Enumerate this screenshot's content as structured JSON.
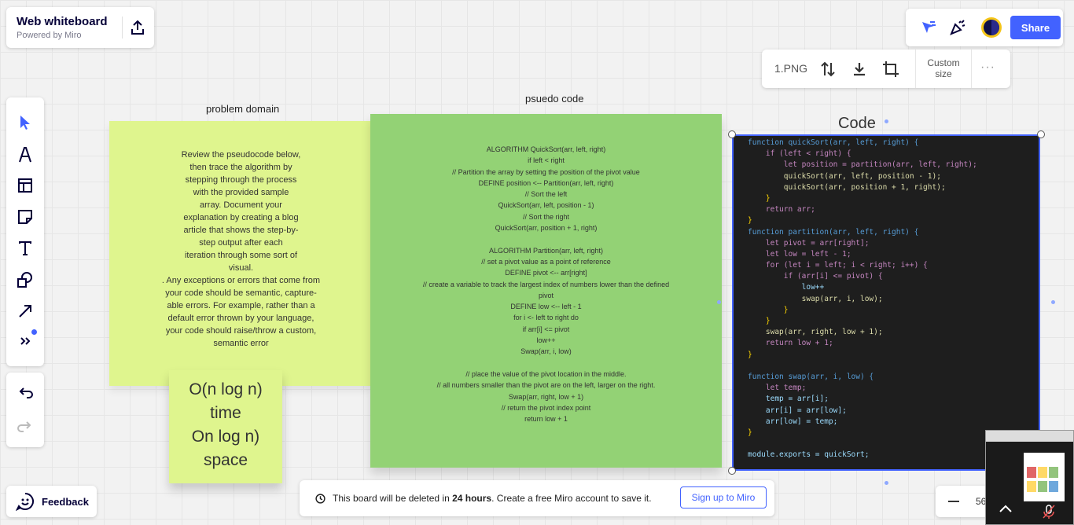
{
  "board": {
    "title": "Web whiteboard",
    "subtitle": "Powered by Miro",
    "share_label": "Share"
  },
  "image_toolbar": {
    "file_name": "1.PNG",
    "custom_size": "Custom size",
    "more": "···"
  },
  "labels": {
    "problem_domain": "problem domain",
    "pseudo_code": "psuedo code",
    "code": "Code"
  },
  "stickies": {
    "problem": "Review the pseudocode below,\nthen trace the algorithm by\nstepping through the process\nwith the provided sample\narray. Document your\nexplanation by creating a blog\narticle that shows the step-by-\nstep output after each\niteration through some sort of\nvisual.\n. Any exceptions or errors that come from\nyour code should be semantic, capture-\nable errors. For example, rather than a\ndefault error thrown by your language,\nyour code should raise/throw a custom,\nsemantic error",
    "complexity": "O(n log n)\ntime\nOn log n)\nspace",
    "pseudo": "ALGORITHM QuickSort(arr, left, right)\nif left < right\n// Partition the array by setting the position of the pivot value\nDEFINE position <-- Partition(arr, left, right)\n// Sort the left\nQuickSort(arr, left, position - 1)\n// Sort the right\nQuickSort(arr, position + 1, right)\n\nALGORITHM Partition(arr, left, right)\n// set a pivot value as a point of reference\nDEFINE pivot <-- arr[right]\n// create a variable to track the largest index of numbers lower than the defined\npivot\nDEFINE low <-- left - 1\nfor i <- left to right do\nif arr[i] <= pivot\nlow++\nSwap(arr, i, low)\n\n// place the value of the pivot location in the middle.\n// all numbers smaller than the pivot are on the left, larger on the right.\nSwap(arr, right, low + 1)\n// return the pivot index point\nreturn low + 1"
  },
  "code_lines": [
    {
      "t": "function quickSort(arr, left, right) {",
      "c": "fn"
    },
    {
      "t": "    if (left < right) {",
      "c": "kw"
    },
    {
      "t": "        let position = partition(arr, left, right);",
      "c": "kw"
    },
    {
      "t": "        quickSort(arr, left, position - 1);",
      "c": "call"
    },
    {
      "t": "        quickSort(arr, position + 1, right);",
      "c": "call"
    },
    {
      "t": "    }",
      "c": "br"
    },
    {
      "t": "    return arr;",
      "c": "kw"
    },
    {
      "t": "}",
      "c": "br"
    },
    {
      "t": "function partition(arr, left, right) {",
      "c": "fn"
    },
    {
      "t": "    let pivot = arr[right];",
      "c": "kw"
    },
    {
      "t": "    let low = left - 1;",
      "c": "kw"
    },
    {
      "t": "    for (let i = left; i < right; i++) {",
      "c": "kw"
    },
    {
      "t": "        if (arr[i] <= pivot) {",
      "c": "kw"
    },
    {
      "t": "            low++",
      "c": "var"
    },
    {
      "t": "            swap(arr, i, low);",
      "c": "call"
    },
    {
      "t": "        }",
      "c": "br"
    },
    {
      "t": "    }",
      "c": "br"
    },
    {
      "t": "    swap(arr, right, low + 1);",
      "c": "call"
    },
    {
      "t": "    return low + 1;",
      "c": "kw"
    },
    {
      "t": "}",
      "c": "br"
    },
    {
      "t": "",
      "c": "br"
    },
    {
      "t": "function swap(arr, i, low) {",
      "c": "fn"
    },
    {
      "t": "    let temp;",
      "c": "kw"
    },
    {
      "t": "    temp = arr[i];",
      "c": "var"
    },
    {
      "t": "    arr[i] = arr[low];",
      "c": "var"
    },
    {
      "t": "    arr[low] = temp;",
      "c": "var"
    },
    {
      "t": "}",
      "c": "br"
    },
    {
      "t": "",
      "c": "br"
    },
    {
      "t": "module.exports = quickSort;",
      "c": "var"
    }
  ],
  "code_colors": {
    "fn": "#569cd6",
    "kw": "#c586c0",
    "call": "#dcdcaa",
    "var": "#9cdcfe",
    "br": "#ffd700"
  },
  "feedback_label": "Feedback",
  "banner": {
    "prefix": "This board will be deleted in ",
    "strong": "24 hours",
    "suffix": ". Create a free Miro account to save it.",
    "signup": "Sign up to Miro"
  },
  "zoom_value": "56",
  "colors": {
    "accent": "#4262ff",
    "sticky_yellow": "#dff58e",
    "sticky_green": "#93d275",
    "code_bg": "#1e1e1e"
  }
}
